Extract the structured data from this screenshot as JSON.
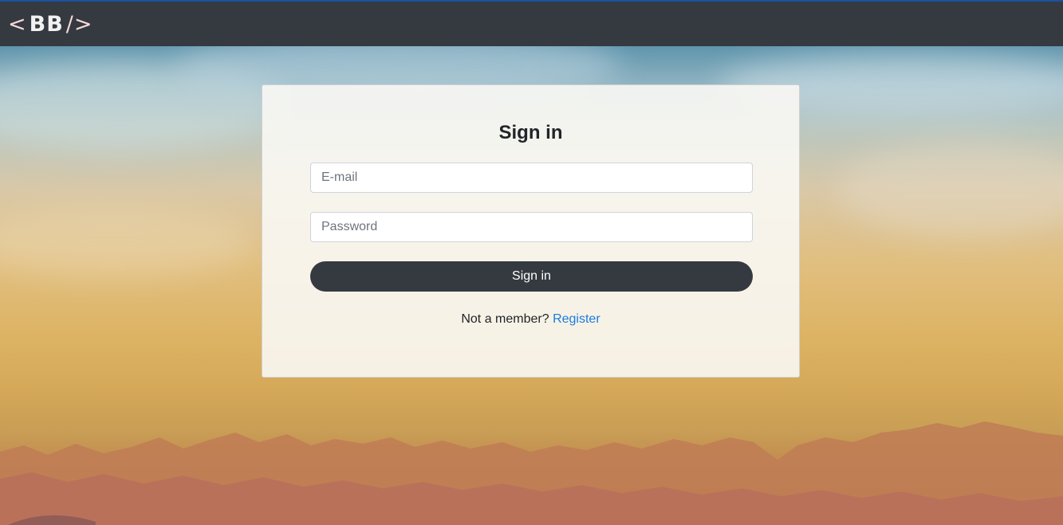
{
  "navbar": {
    "brand_left": "<",
    "brand_text": "BB",
    "brand_right": "/>"
  },
  "login": {
    "title": "Sign in",
    "email_placeholder": "E-mail",
    "email_value": "",
    "password_placeholder": "Password",
    "password_value": "",
    "submit_label": "Sign in",
    "register_prompt": "Not a member?",
    "register_link": "Register"
  },
  "colors": {
    "navbar": "#343a40",
    "button": "#343a40",
    "link": "#1a7ce0"
  }
}
